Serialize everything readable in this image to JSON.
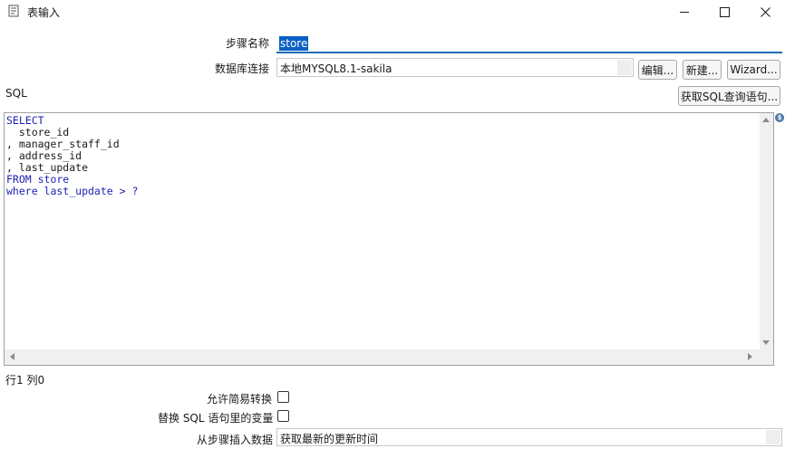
{
  "window": {
    "title": "表输入",
    "controls": [
      "minimize-icon",
      "maximize-icon",
      "close-icon"
    ]
  },
  "form": {
    "step_name_label": "步骤名称",
    "step_name_value": "store",
    "db_connection_label": "数据库连接",
    "db_connection_value": "本地MYSQL8.1-sakila",
    "edit_button": "编辑...",
    "new_button": "新建...",
    "wizard_button": "Wizard...",
    "sql_label": "SQL",
    "get_sql_button": "获取SQL查询语句...",
    "sql_lines": [
      "SELECT",
      "  store_id",
      ", manager_staff_id",
      ", address_id",
      ", last_update",
      "FROM store",
      "where last_update > ?"
    ],
    "cursor_position": "行1 列0",
    "lazy_conversion_label": "允许简易转换",
    "lazy_conversion_checked": false,
    "replace_variables_label": "替换 SQL 语句里的变量",
    "replace_variables_checked": false,
    "insert_from_step_label": "从步骤插入数据",
    "insert_from_step_value": "获取最新的更新时间"
  },
  "colors": {
    "selection": "#0a5fc4",
    "focus_underline": "#1c6cb4",
    "sql_keyword": "#1d1db3",
    "help_icon": "#5379a8"
  }
}
